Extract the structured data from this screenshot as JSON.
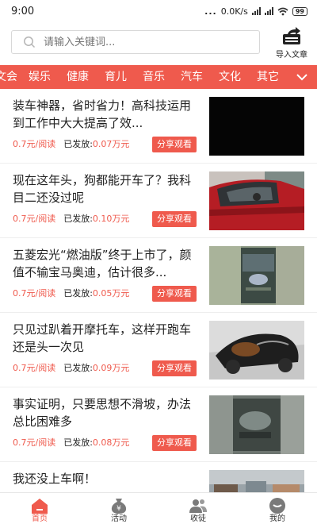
{
  "status_bar": {
    "time": "9:00",
    "dots": "...",
    "network_speed": "0.0K/s",
    "battery": "99"
  },
  "search": {
    "placeholder": "请输入关键词..."
  },
  "header": {
    "import_label": "导入文章"
  },
  "categories": [
    "文会",
    "娱乐",
    "健康",
    "育儿",
    "音乐",
    "汽车",
    "文化",
    "其它"
  ],
  "articles": [
    {
      "title": "装车神器，省时省力！高科技运用到工作中大大提高了效...",
      "rate": "0.7元/阅读",
      "issued_label": "已发放:",
      "issued_value": "0.07万元",
      "share_label": "分享观看",
      "thumb": "black-video-thumb"
    },
    {
      "title": "现在这年头，狗都能开车了？我科目二还没过呢",
      "rate": "0.7元/阅读",
      "issued_label": "已发放:",
      "issued_value": "0.10万元",
      "share_label": "分享观看",
      "thumb": "red-car-thumb"
    },
    {
      "title": "五菱宏光“燃油版”终于上市了，颜值不输宝马奥迪，估计很多...",
      "rate": "0.7元/阅读",
      "issued_label": "已发放:",
      "issued_value": "0.05万元",
      "share_label": "分享观看",
      "thumb": "blurred-phone-video-thumb"
    },
    {
      "title": "只见过趴着开摩托车，这样开跑车还是头一次见",
      "rate": "0.7元/阅读",
      "issued_label": "已发放:",
      "issued_value": "0.09万元",
      "share_label": "分享观看",
      "thumb": "sports-car-interior-thumb"
    },
    {
      "title": "事实证明，只要思想不滑坡，办法总比困难多",
      "rate": "0.7元/阅读",
      "issued_label": "已发放:",
      "issued_value": "0.08万元",
      "share_label": "分享观看",
      "thumb": "car-engine-thumb"
    },
    {
      "title": "我还没上车啊！",
      "thumb": "street-scene-thumb"
    }
  ],
  "tabbar": {
    "items": [
      {
        "label": "首页",
        "icon": "home-icon",
        "active": true
      },
      {
        "label": "活动",
        "icon": "money-bag-icon",
        "active": false
      },
      {
        "label": "收徒",
        "icon": "people-icon",
        "active": false
      },
      {
        "label": "我的",
        "icon": "profile-icon",
        "active": false
      }
    ]
  },
  "colors": {
    "accent": "#ef5a4d",
    "text": "#222222",
    "placeholder": "#999999"
  }
}
